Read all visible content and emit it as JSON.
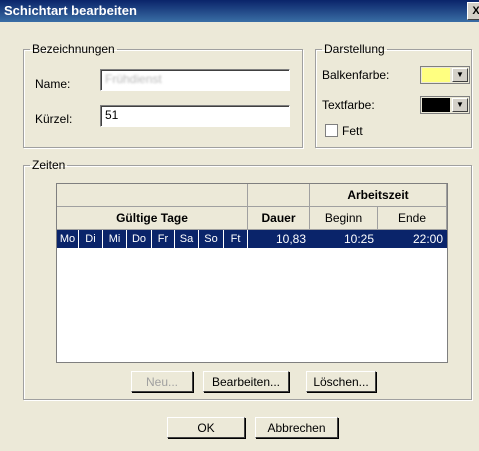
{
  "window": {
    "title": "Schichtart bearbeiten",
    "close": "X"
  },
  "bezeichnungen": {
    "legend": "Bezeichnungen",
    "name_label": "Name:",
    "name_value": "Frühdienst",
    "kuerzel_label": "Kürzel:",
    "kuerzel_value": "51"
  },
  "darstellung": {
    "legend": "Darstellung",
    "balkenfarbe_label": "Balkenfarbe:",
    "balkenfarbe_color": "#ffff80",
    "textfarbe_label": "Textfarbe:",
    "textfarbe_color": "#000000",
    "fett_label": "Fett"
  },
  "zeiten": {
    "legend": "Zeiten",
    "table": {
      "header_arbeitszeit": "Arbeitszeit",
      "header_gueltige_tage": "Gültige Tage",
      "header_dauer": "Dauer",
      "header_beginn": "Beginn",
      "header_ende": "Ende",
      "rows": [
        {
          "days": [
            "Mo",
            "Di",
            "Mi",
            "Do",
            "Fr",
            "Sa",
            "So",
            "Ft"
          ],
          "dauer": "10,83",
          "beginn": "10:25",
          "ende": "22:00"
        }
      ]
    },
    "buttons": {
      "neu": "Neu...",
      "bearbeiten": "Bearbeiten...",
      "loeschen": "Löschen..."
    }
  },
  "dialog_buttons": {
    "ok": "OK",
    "abbrechen": "Abbrechen"
  }
}
